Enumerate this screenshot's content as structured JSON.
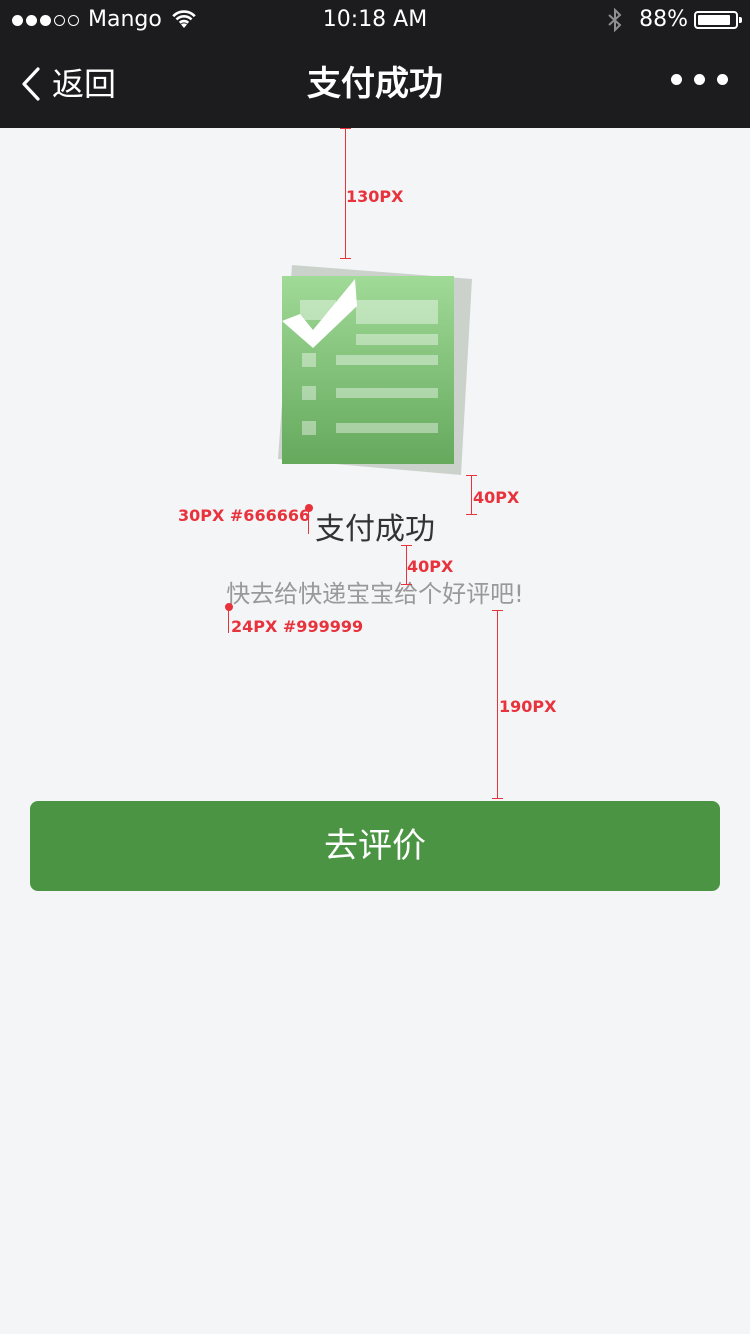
{
  "status_bar": {
    "carrier": "Mango",
    "time": "10:18 AM",
    "battery": "88%",
    "battery_level": 0.88
  },
  "nav": {
    "back_label": "返回",
    "title": "支付成功",
    "more_icon": "ellipsis-icon"
  },
  "content": {
    "illustration_icon": "checklist-document-icon",
    "title": "支付成功",
    "subtitle": "快去给快递宝宝给个好评吧!",
    "button_label": "去评价"
  },
  "annotations": {
    "top_gap": "130PX",
    "icon_gap": "40PX",
    "title_spec": "30PX #666666",
    "title_gap": "40PX",
    "sub_spec": "24PX #999999",
    "button_gap": "190PX"
  },
  "colors": {
    "nav_bg": "#1c1c1e",
    "page_bg": "#f4f5f7",
    "button_bg": "#4a9443",
    "annotation": "#e8323c"
  }
}
